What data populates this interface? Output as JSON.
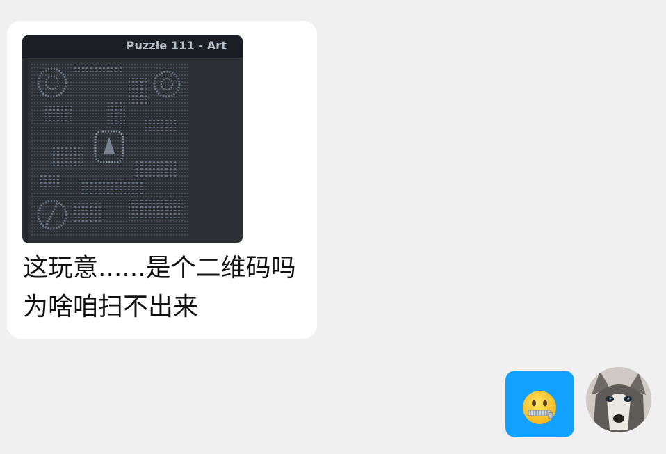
{
  "incoming_message": {
    "image": {
      "title": "Puzzle 111 - Art",
      "icon": "ascii-art-qr-image"
    },
    "text": "这玩意......是个二维码吗\n为啥咱扫不出来"
  },
  "outgoing_message": {
    "emoji": "zipper-mouth-face",
    "bubble_color": "#12a1ff"
  },
  "avatar": {
    "icon": "husky-avatar"
  }
}
